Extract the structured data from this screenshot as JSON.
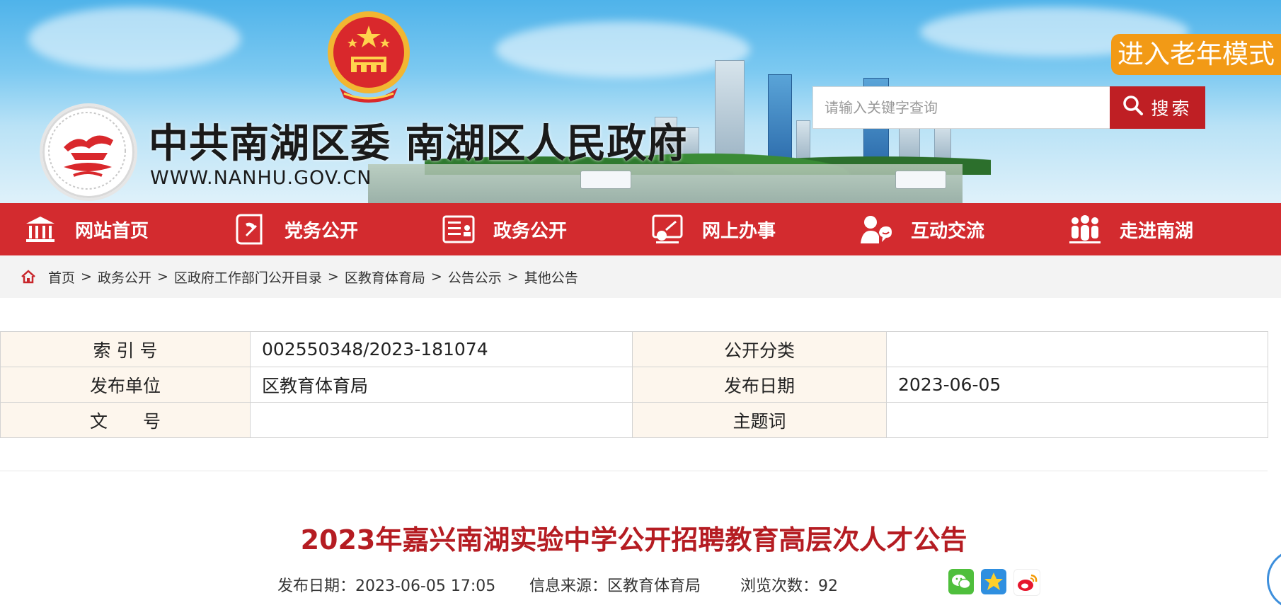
{
  "header": {
    "site_title": "中共南湖区委 南湖区人民政府",
    "site_url": "WWW.NANHU.GOV.CN",
    "elder_mode_label": "进入老年模式",
    "search": {
      "placeholder": "请输入关键字查询",
      "value": "",
      "button_label": "搜索"
    }
  },
  "nav": {
    "items": [
      {
        "label": "网站首页",
        "icon": "building-icon"
      },
      {
        "label": "党务公开",
        "icon": "party-emblem-icon"
      },
      {
        "label": "政务公开",
        "icon": "document-icon"
      },
      {
        "label": "网上办事",
        "icon": "online-service-icon"
      },
      {
        "label": "互动交流",
        "icon": "chat-person-icon"
      },
      {
        "label": "走进南湖",
        "icon": "people-icon"
      }
    ]
  },
  "breadcrumb": {
    "items": [
      "首页",
      "政务公开",
      "区政府工作部门公开目录",
      "区教育体育局",
      "公告公示",
      "其他公告"
    ],
    "separator": ">"
  },
  "info_table": {
    "rows": [
      {
        "label1": "索 引 号",
        "value1": "002550348/2023-181074",
        "label2": "公开分类",
        "value2": ""
      },
      {
        "label1": "发布单位",
        "value1": "区教育体育局",
        "label2": "发布日期",
        "value2": "2023-06-05"
      },
      {
        "label1": "文　　号",
        "value1": "",
        "label2": "主题词",
        "value2": ""
      }
    ]
  },
  "article": {
    "title": "2023年嘉兴南湖实验中学公开招聘教育高层次人才公告",
    "meta": {
      "date_label": "发布日期：",
      "date": "2023-06-05 17:05",
      "source_label": "信息来源：",
      "source": "区教育体育局",
      "views_label": "浏览次数：",
      "views": "92"
    },
    "share_icons": [
      "wechat-icon",
      "qzone-icon",
      "weibo-icon"
    ]
  },
  "colors": {
    "nav_red": "#d32b2f",
    "title_red": "#b51c22",
    "elder_orange": "#f29a16",
    "search_button": "#bf1f24",
    "table_label_bg": "#fdf6ed"
  }
}
